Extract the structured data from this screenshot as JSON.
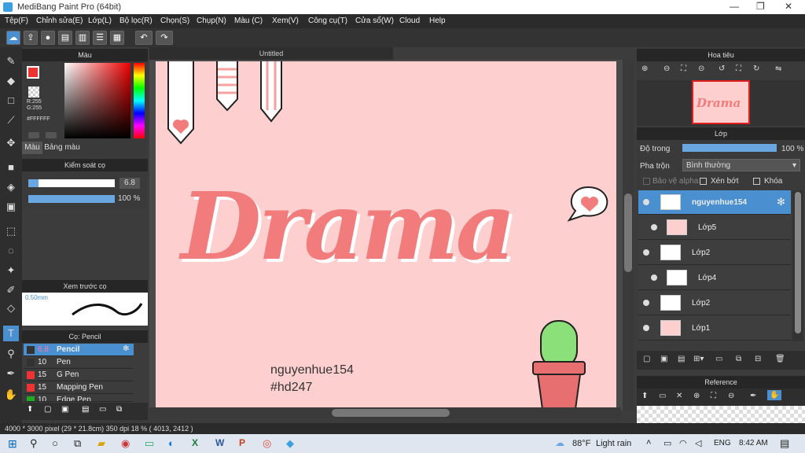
{
  "window": {
    "title": "MediBang Paint Pro (64bit)"
  },
  "menu": [
    "Tệp(F)",
    "Chỉnh sửa(E)",
    "Lớp(L)",
    "Bộ lọc(R)",
    "Chọn(S)",
    "Chụp(N)",
    "Màu (C)",
    "Xem(V)",
    "Công cụ(T)",
    "Cửa sổ(W)",
    "Cloud",
    "Help"
  ],
  "color_panel": {
    "title": "Màu",
    "r": "R:255",
    "g": "G:255",
    "hex": "#FFFFFF",
    "tab_color": "Màu",
    "tab_palette": "Bảng màu"
  },
  "brush_control": {
    "title": "Kiểm soát cọ",
    "size": "6.8",
    "opacity": "100 %",
    "size_level": 0.1,
    "opacity_level": 1.0
  },
  "brush_preview": {
    "title": "Xem trước cọ",
    "size": "0.50mm"
  },
  "brush_list": {
    "title": "Cọ: Pencil",
    "items": [
      {
        "size": "6.8",
        "name": "Pencil",
        "selected": true
      },
      {
        "size": "10",
        "name": "Pen"
      },
      {
        "size": "15",
        "name": "G Pen"
      },
      {
        "size": "15",
        "name": "Mapping Pen"
      },
      {
        "size": "10",
        "name": "Edge Pen"
      }
    ]
  },
  "canvas": {
    "tab": "Untitled",
    "artwork_text": "Drama",
    "sig_name": "nguyenhue154",
    "sig_tag": "#hd247"
  },
  "navigator": {
    "title": "Hoa tiêu",
    "thumb_text": "Drama"
  },
  "layers": {
    "title": "Lớp",
    "opacity_label": "Độ trong",
    "opacity_value": "100 %",
    "blend_label": "Pha trộn",
    "blend_value": "Bình thường",
    "protect_alpha": "Bảo vệ alpha",
    "clip": "Xén bớt",
    "lock": "Khóa",
    "items": [
      {
        "name": "nguyenhue154",
        "selected": true
      },
      {
        "name": "Lớp5"
      },
      {
        "name": "Lớp2"
      },
      {
        "name": "Lớp4"
      },
      {
        "name": "Lớp2"
      },
      {
        "name": "Lớp1"
      }
    ]
  },
  "reference": {
    "title": "Reference"
  },
  "status": {
    "text": "4000 * 3000 pixel   (29 * 21.8cm)   350 dpi   18 %   ( 4013, 2412 )"
  },
  "taskbar": {
    "weather_temp": "88°F",
    "weather_desc": "Light rain",
    "lang": "ENG",
    "time": "8:42 AM"
  },
  "colors": {
    "accent": "#4a8fd0",
    "canvas_bg": "#fdcfcf",
    "drama": "#f27c7c"
  }
}
